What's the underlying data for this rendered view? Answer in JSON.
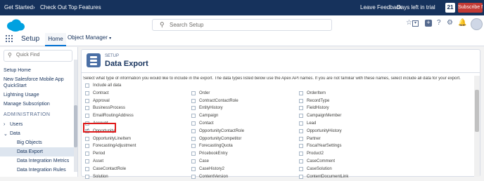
{
  "topbar": {
    "get_started": "Get Started",
    "check_out": "Check Out Top Features",
    "leave_feedback": "Leave Feedback",
    "days_left": "Days left in trial",
    "days_count": "21",
    "subscribe": "Subscribe Now"
  },
  "header": {
    "search_placeholder": "Search Setup",
    "app_title": "Setup",
    "tab_home": "Home",
    "tab_object_manager": "Object Manager"
  },
  "sidebar": {
    "quick_find": "Quick Find",
    "setup_home": "Setup Home",
    "mobile_app_1": "New Salesforce Mobile App",
    "mobile_app_2": "QuickStart",
    "lightning_usage": "Lightning Usage",
    "manage_subscription": "Manage Subscription",
    "administration": "ADMINISTRATION",
    "users": "Users",
    "data": "Data",
    "big_objects": "Big Objects",
    "data_export": "Data Export",
    "data_integration_metrics": "Data Integration Metrics",
    "data_integration_rules": "Data Integration Rules"
  },
  "main": {
    "setup_label": "SETUP",
    "title": "Data Export",
    "instructions": "Select what type of information you would like to include in the export. The data types listed below use the Apex API names. If you are not familiar with these names, select include all data for your export.",
    "include_all": "Include all data",
    "columns": [
      [
        "Contract",
        "Approval",
        "BusinessProcess",
        "EmailRoutingAddress",
        "Account",
        "Opportunity",
        "OpportunityLineItem",
        "ForecastingAdjustment",
        "Period",
        "Asset",
        "CaseContactRole",
        "Solution"
      ],
      [
        "Order",
        "ContractContactRole",
        "EntityHistory",
        "Campaign",
        "Contact",
        "OpportunityContactRole",
        "OpportunityCompetitor",
        "ForecastingQuota",
        "PricebookEntry",
        "Case",
        "CaseHistory2",
        "ContentVersion"
      ],
      [
        "OrderItem",
        "RecordType",
        "FieldHistory",
        "CampaignMember",
        "Lead",
        "OpportunityHistory",
        "Partner",
        "FiscalYearSettings",
        "Product2",
        "CaseComment",
        "CaseSolution",
        "ContentDocumentLink"
      ]
    ],
    "checked": "Opportunity"
  }
}
